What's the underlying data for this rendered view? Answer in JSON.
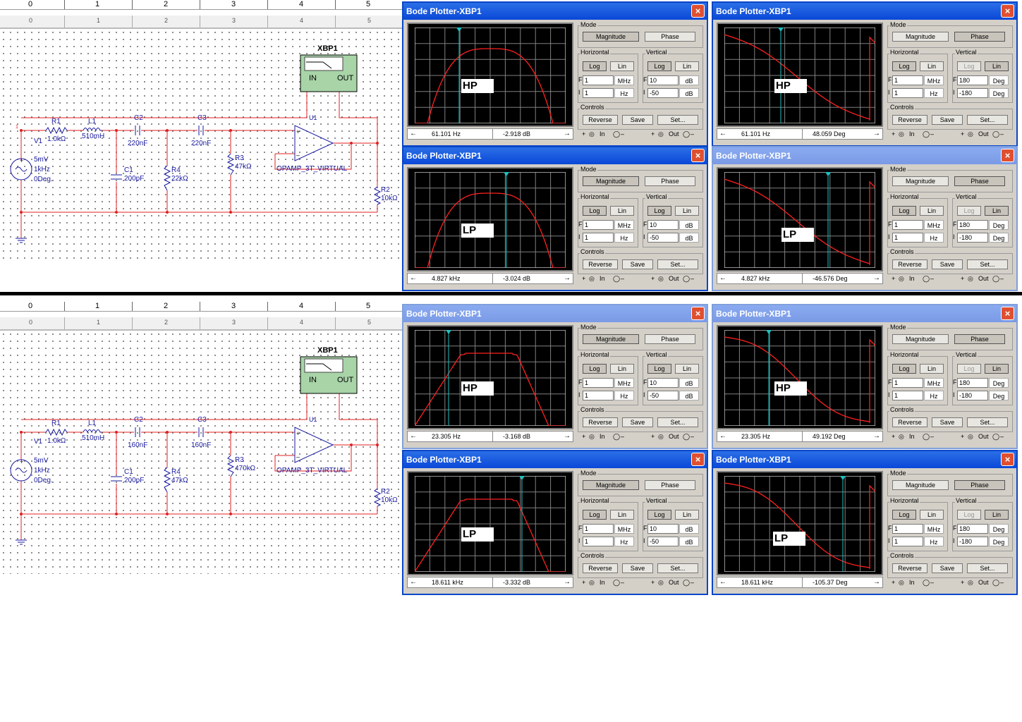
{
  "rulers": {
    "ticks": [
      "0",
      "1",
      "2",
      "3",
      "4",
      "5"
    ],
    "ticks_small": [
      "0",
      "1",
      "2",
      "3",
      "4",
      "5"
    ]
  },
  "schematics": [
    {
      "instrument": "XBP1",
      "u1": "U1",
      "source": {
        "name": "V1",
        "amp": "5mV",
        "freq": "1kHz",
        "phase": "0Deg."
      },
      "r1": {
        "name": "R1",
        "value": "1.0kΩ"
      },
      "l1": {
        "name": "L1",
        "value": "510mH"
      },
      "c2": {
        "name": "C2",
        "value": "220nF"
      },
      "c3": {
        "name": "C3",
        "value": "220nF"
      },
      "c1": {
        "name": "C1",
        "value": "200pF"
      },
      "r4": {
        "name": "R4",
        "value": "22kΩ"
      },
      "r3": {
        "name": "R3",
        "value": "47kΩ"
      },
      "r2": {
        "name": "R2",
        "value": "10kΩ"
      },
      "opamp": "OPAMP_3T_VIRTUAL",
      "in": "IN",
      "out": "OUT"
    },
    {
      "instrument": "XBP1",
      "u1": "U1",
      "source": {
        "name": "V1",
        "amp": "5mV",
        "freq": "1kHz",
        "phase": "0Deg."
      },
      "r1": {
        "name": "R1",
        "value": "1.0kΩ"
      },
      "l1": {
        "name": "L1",
        "value": "510mH"
      },
      "c2": {
        "name": "C2",
        "value": "160nF"
      },
      "c3": {
        "name": "C3",
        "value": "160nF"
      },
      "c1": {
        "name": "C1",
        "value": "200pF"
      },
      "r4": {
        "name": "R4",
        "value": "47kΩ"
      },
      "r3": {
        "name": "R3",
        "value": "470kΩ"
      },
      "r2": {
        "name": "R2",
        "value": "10kΩ"
      },
      "opamp": "OPAMP_3T_VIRTUAL",
      "in": "IN",
      "out": "OUT"
    }
  ],
  "labels": {
    "mode": "Mode",
    "magnitude": "Magnitude",
    "phase": "Phase",
    "horizontal": "Horizontal",
    "vertical": "Vertical",
    "log": "Log",
    "lin": "Lin",
    "controls": "Controls",
    "reverse": "Reverse",
    "save": "Save",
    "set": "Set...",
    "f": "F",
    "i": "I",
    "in": "In",
    "out": "Out",
    "plus": "+",
    "minus": "–",
    "close": "×",
    "left": "←",
    "right": "→"
  },
  "windows": [
    {
      "title": "Bode Plotter-XBP1",
      "mode": "mag",
      "tag": "HP",
      "h_f": "1",
      "h_f_unit": "MHz",
      "h_i": "1",
      "h_i_unit": "Hz",
      "v_f": "10",
      "v_f_unit": "dB",
      "v_i": "-50",
      "v_i_unit": "dB",
      "readout_x": "61.101",
      "readout_x_unit": "Hz",
      "readout_y": "-2.918 dB",
      "v_log_disabled": false
    },
    {
      "title": "Bode Plotter-XBP1",
      "mode": "phase",
      "tag": "HP",
      "h_f": "1",
      "h_f_unit": "MHz",
      "h_i": "1",
      "h_i_unit": "Hz",
      "v_f": "180",
      "v_f_unit": "Deg",
      "v_i": "-180",
      "v_i_unit": "Deg",
      "readout_x": "61.101",
      "readout_x_unit": "Hz",
      "readout_y": "48.059 Deg",
      "v_log_disabled": true
    },
    {
      "title": "Bode Plotter-XBP1",
      "mode": "mag",
      "tag": "LP",
      "h_f": "1",
      "h_f_unit": "MHz",
      "h_i": "1",
      "h_i_unit": "Hz",
      "v_f": "10",
      "v_f_unit": "dB",
      "v_i": "-50",
      "v_i_unit": "dB",
      "readout_x": "4.827 kHz",
      "readout_x_unit": "",
      "readout_y": "-3.024 dB",
      "v_log_disabled": false
    },
    {
      "title": "Bode Plotter-XBP1",
      "mode": "phase",
      "tag": "LP",
      "h_f": "1",
      "h_f_unit": "MHz",
      "h_i": "1",
      "h_i_unit": "Hz",
      "v_f": "180",
      "v_f_unit": "Deg",
      "v_i": "-180",
      "v_i_unit": "Deg",
      "readout_x": "4.827 kHz",
      "readout_x_unit": "",
      "readout_y": "-46.576 Deg",
      "v_log_disabled": true
    },
    {
      "title": "Bode Plotter-XBP1",
      "mode": "mag",
      "tag": "HP",
      "h_f": "1",
      "h_f_unit": "MHz",
      "h_i": "1",
      "h_i_unit": "Hz",
      "v_f": "10",
      "v_f_unit": "dB",
      "v_i": "-50",
      "v_i_unit": "dB",
      "readout_x": "23.305",
      "readout_x_unit": "Hz",
      "readout_y": "-3.168 dB",
      "v_log_disabled": false
    },
    {
      "title": "Bode Plotter-XBP1",
      "mode": "phase",
      "tag": "HP",
      "h_f": "1",
      "h_f_unit": "MHz",
      "h_i": "1",
      "h_i_unit": "Hz",
      "v_f": "180",
      "v_f_unit": "Deg",
      "v_i": "-180",
      "v_i_unit": "Deg",
      "readout_x": "23.305",
      "readout_x_unit": "Hz",
      "readout_y": "49.192 Deg",
      "v_log_disabled": true
    },
    {
      "title": "Bode Plotter-XBP1",
      "mode": "mag",
      "tag": "LP",
      "h_f": "1",
      "h_f_unit": "MHz",
      "h_i": "1",
      "h_i_unit": "Hz",
      "v_f": "10",
      "v_f_unit": "dB",
      "v_i": "-50",
      "v_i_unit": "dB",
      "readout_x": "18.611 kHz",
      "readout_x_unit": "",
      "readout_y": "-3.332 dB",
      "v_log_disabled": false
    },
    {
      "title": "Bode Plotter-XBP1",
      "mode": "phase",
      "tag": "LP",
      "h_f": "1",
      "h_f_unit": "MHz",
      "h_i": "1",
      "h_i_unit": "Hz",
      "v_f": "180",
      "v_f_unit": "Deg",
      "v_i": "-180",
      "v_i_unit": "Deg",
      "readout_x": "18.611 kHz",
      "readout_x_unit": "",
      "readout_y": "-105.37 Deg",
      "v_log_disabled": true
    }
  ],
  "colors": {
    "trace": "#ff2020",
    "cursor": "#20c0c0",
    "wire": "#e02020",
    "component": "#1a1aa0",
    "title_active": "#0a48d8"
  }
}
